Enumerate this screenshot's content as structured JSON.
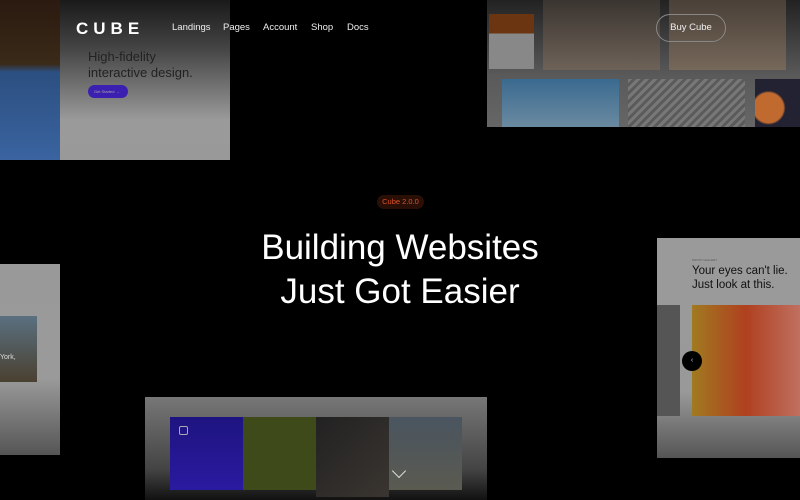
{
  "header": {
    "logo": "CUBE",
    "nav": [
      "Landings",
      "Pages",
      "Account",
      "Shop",
      "Docs"
    ],
    "buy_button": "Buy Cube"
  },
  "hero": {
    "badge": "Cube 2.0.0",
    "title_line1": "Building Websites",
    "title_line2": "Just Got Easier",
    "accent": "#e0502a"
  },
  "preview_top_left": {
    "heading_line1": "High-fidelity",
    "heading_line2": "interactive design.",
    "button": "Get Started",
    "button_color": "#3a1fb0"
  },
  "preview_right": {
    "eyebrow": "PHOTO GALLERY",
    "heading_line1": "Your eyes can't lie.",
    "heading_line2": "Just look at this."
  },
  "preview_left": {
    "caption": "York,"
  },
  "scroll_icon": "chevron-down-icon"
}
